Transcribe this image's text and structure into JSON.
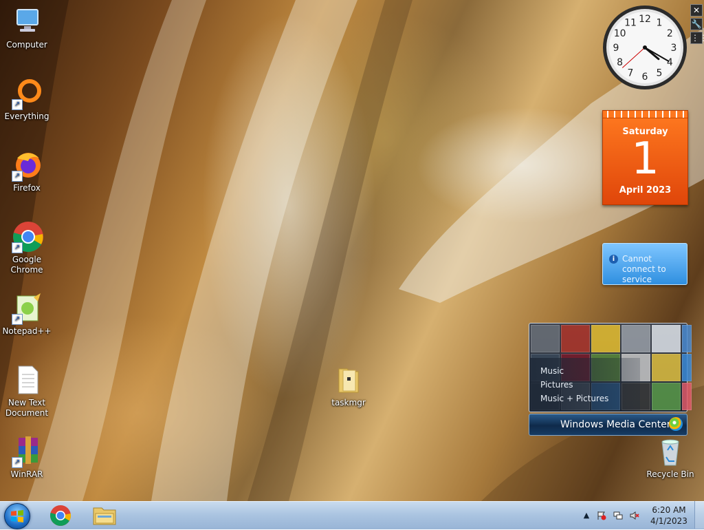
{
  "desktop": {
    "icons": [
      {
        "label": "Computer",
        "icon": "computer-icon",
        "shortcut": false
      },
      {
        "label": "Everything",
        "icon": "everything-icon",
        "shortcut": true
      },
      {
        "label": "Firefox",
        "icon": "firefox-icon",
        "shortcut": true
      },
      {
        "label": "Google Chrome",
        "icon": "chrome-icon",
        "shortcut": true
      },
      {
        "label": "Notepad++",
        "icon": "notepadpp-icon",
        "shortcut": true
      },
      {
        "label": "New Text Document",
        "icon": "text-document-icon",
        "shortcut": false
      },
      {
        "label": "WinRAR",
        "icon": "winrar-icon",
        "shortcut": true
      }
    ],
    "folder": {
      "label": "taskmgr",
      "icon": "folder-icon"
    },
    "recycle_bin": {
      "label": "Recycle Bin",
      "icon": "recycle-bin-icon"
    }
  },
  "gadgets": {
    "clock": {
      "hour": 4,
      "minute": 20,
      "second": 38,
      "numbers": [
        "12",
        "1",
        "2",
        "3",
        "4",
        "5",
        "6",
        "7",
        "8",
        "9",
        "10",
        "11"
      ]
    },
    "controls": {
      "close": "✕",
      "options": "🔧",
      "drag": "⋮⋮"
    },
    "calendar": {
      "day_of_week": "Saturday",
      "day": "1",
      "month_year": "April 2023"
    },
    "feed": {
      "message": "Cannot connect to service",
      "icon": "info-icon"
    },
    "media_center": {
      "links": [
        "Music",
        "Pictures",
        "Music + Pictures"
      ],
      "title": "Windows Media Center"
    }
  },
  "taskbar": {
    "start": "start-button",
    "pinned": [
      {
        "name": "chrome",
        "icon": "chrome-icon"
      },
      {
        "name": "file-explorer",
        "icon": "folder-icon"
      }
    ],
    "tray": {
      "time": "6:20 AM",
      "date": "4/1/2023"
    }
  },
  "colors": {
    "calendar_orange": "#f26512",
    "feed_blue": "#3f9ce8",
    "taskbar": "#b4cbe6"
  }
}
